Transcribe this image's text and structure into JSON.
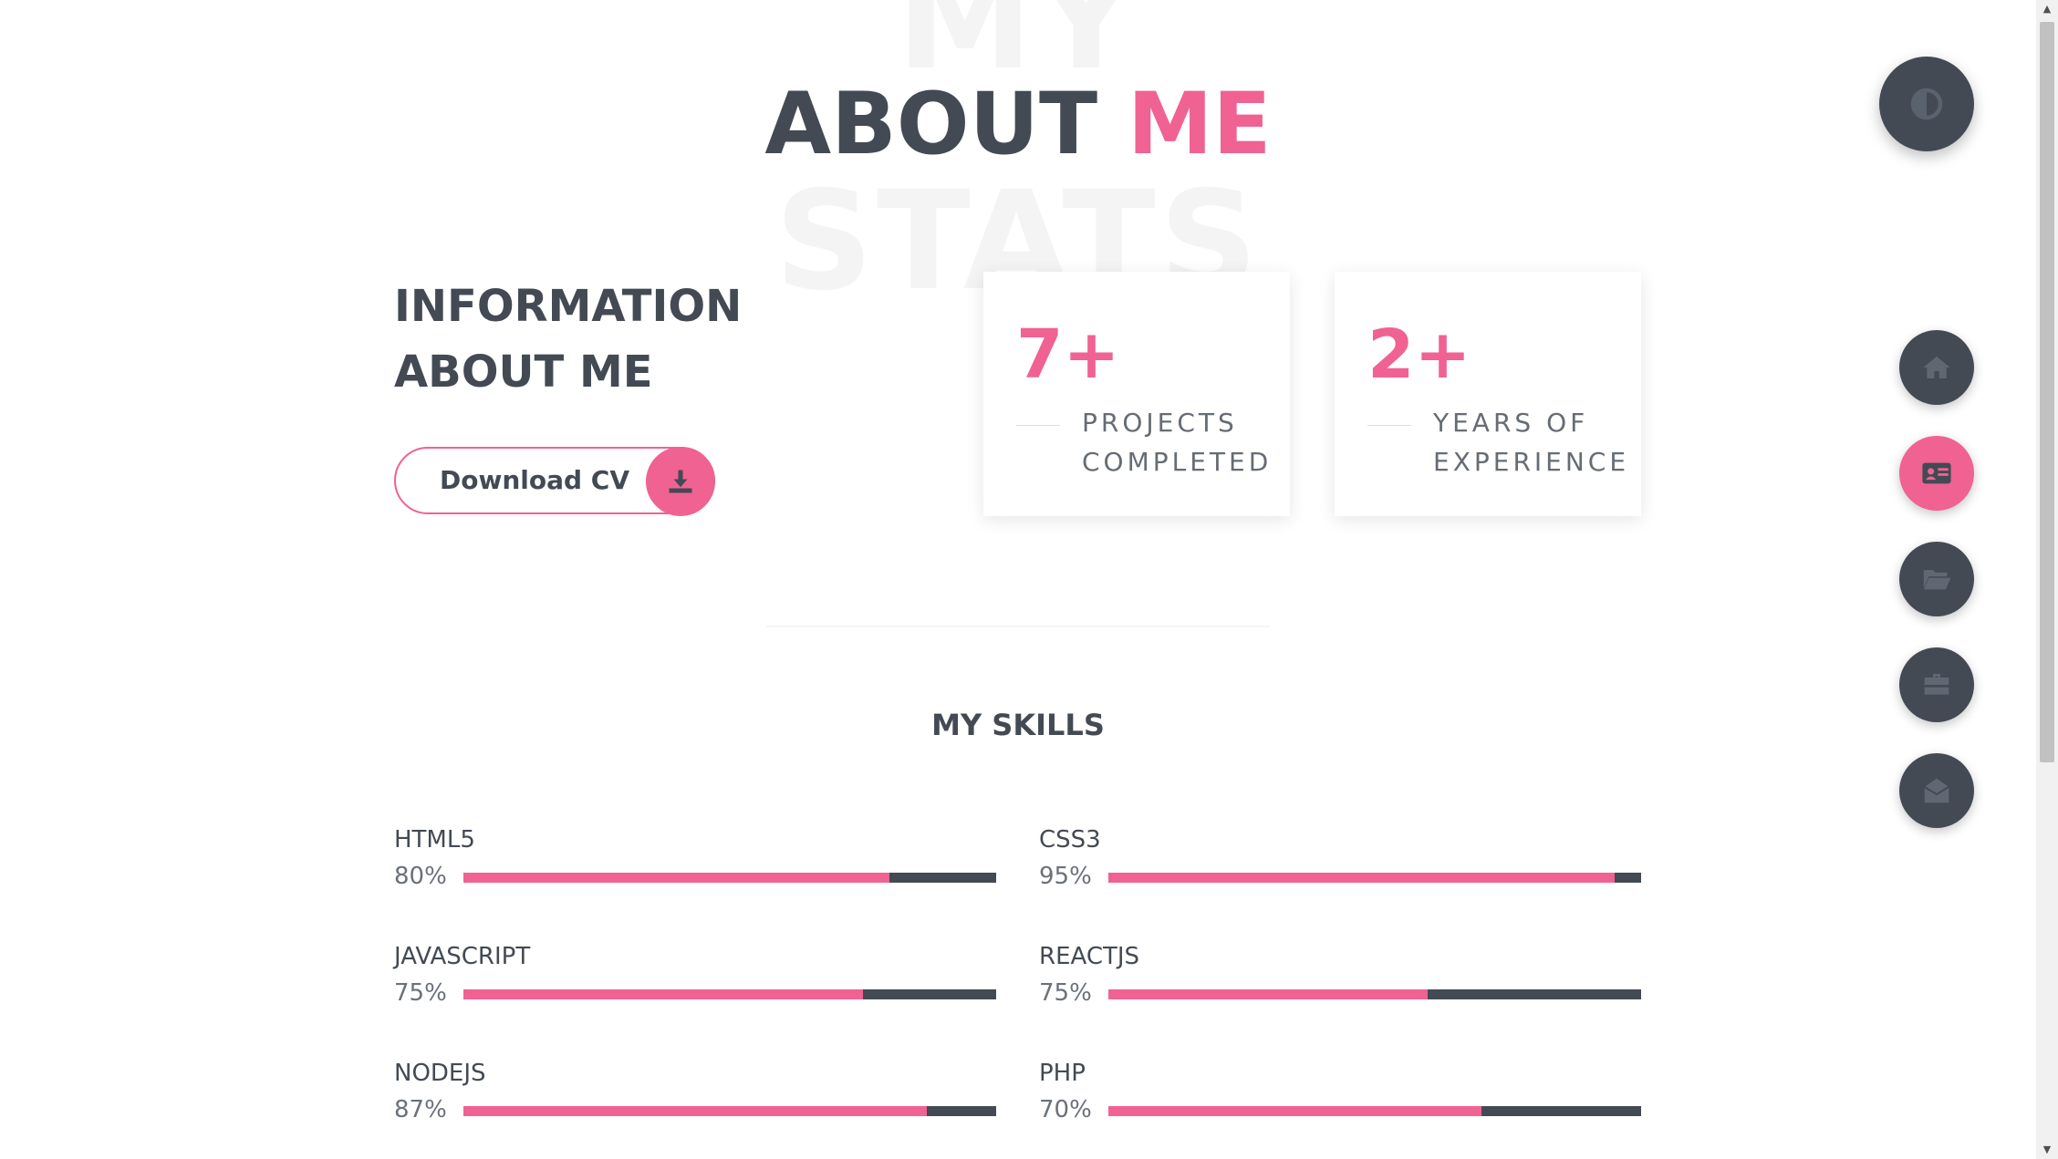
{
  "header": {
    "bg_top": "MY",
    "bg_bottom": "STATS",
    "title_main": "ABOUT",
    "title_accent": "ME"
  },
  "info": {
    "heading": "INFORMATION ABOUT ME",
    "download_label": "Download CV"
  },
  "stats": [
    {
      "number": "7+",
      "label": "PROJECTS COMPLETED"
    },
    {
      "number": "2+",
      "label": "YEARS OF EXPERIENCE"
    }
  ],
  "skills_title": "MY SKILLS",
  "skills": [
    {
      "name": "HTML5",
      "percent_label": "80%",
      "level": 0.8
    },
    {
      "name": "CSS3",
      "percent_label": "95%",
      "level": 0.95
    },
    {
      "name": "JAVASCRIPT",
      "percent_label": "75%",
      "level": 0.75
    },
    {
      "name": "REACTJS",
      "percent_label": "75%",
      "level": 0.6
    },
    {
      "name": "NODEJS",
      "percent_label": "87%",
      "level": 0.87
    },
    {
      "name": "PHP",
      "percent_label": "70%",
      "level": 0.7
    }
  ],
  "nav": {
    "theme_icon": "contrast-icon",
    "items": [
      {
        "icon": "home-icon",
        "active": false
      },
      {
        "icon": "id-card-icon",
        "active": true
      },
      {
        "icon": "folder-open-icon",
        "active": false
      },
      {
        "icon": "briefcase-icon",
        "active": false
      },
      {
        "icon": "envelope-open-icon",
        "active": false
      }
    ]
  },
  "colors": {
    "accent": "#f06292",
    "dark": "#434a54",
    "background": "#ffffff"
  }
}
